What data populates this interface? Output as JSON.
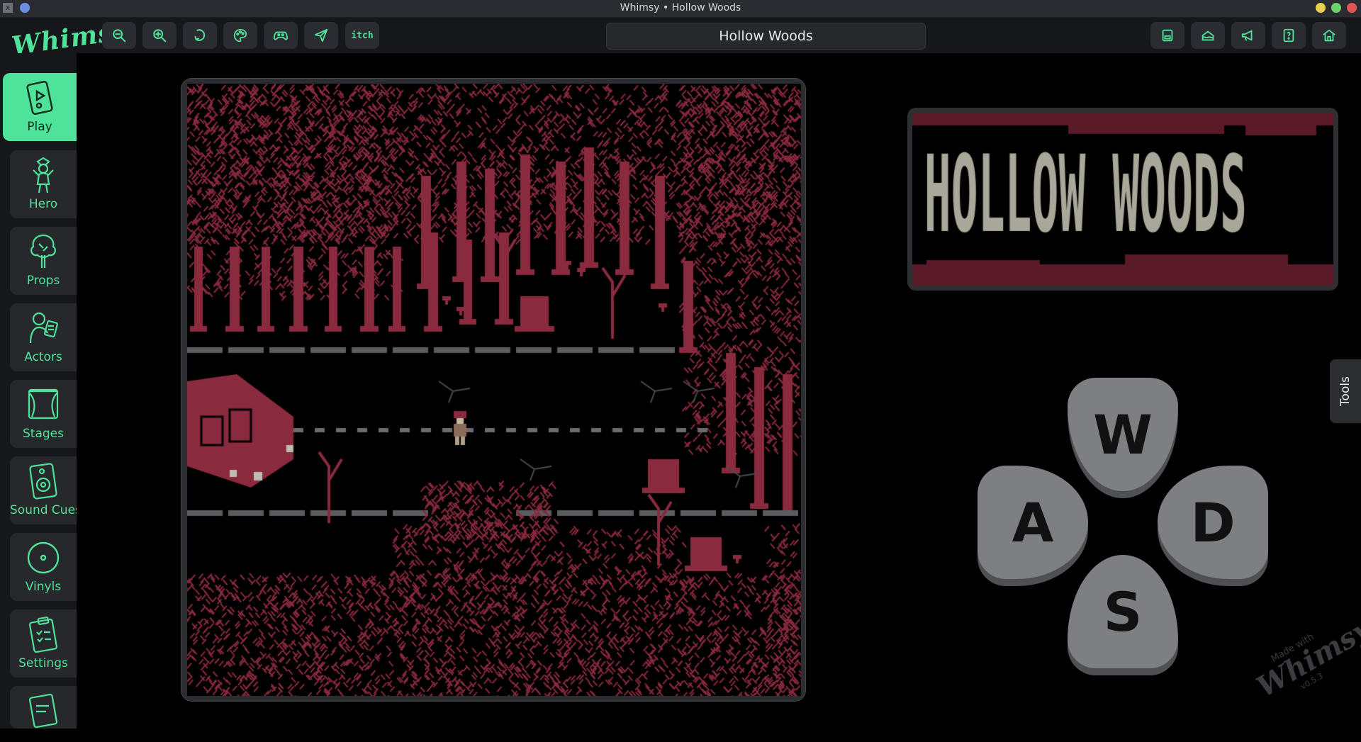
{
  "window": {
    "title": "Whimsy • Hollow Woods",
    "close_glyph": "x"
  },
  "app": {
    "logo": "Whimsy"
  },
  "toolbar": {
    "game_name": "Hollow Woods",
    "itch_label": "itch",
    "left_icons": [
      "zoom-out-icon",
      "zoom-in-icon",
      "reload-icon",
      "palette-icon",
      "gamepad-icon",
      "send-icon",
      "itch-icon"
    ],
    "right_icons": [
      "save-icon",
      "cake-icon",
      "megaphone-icon",
      "help-icon",
      "home-icon"
    ]
  },
  "sidebar": {
    "items": [
      {
        "label": "Play",
        "icon": "play-card-icon",
        "active": true
      },
      {
        "label": "Hero",
        "icon": "hero-icon"
      },
      {
        "label": "Props",
        "icon": "tree-icon"
      },
      {
        "label": "Actors",
        "icon": "actor-icon"
      },
      {
        "label": "Stages",
        "icon": "stage-icon"
      },
      {
        "label": "Sound Cues",
        "icon": "speaker-icon"
      },
      {
        "label": "Vinyls",
        "icon": "vinyl-icon"
      },
      {
        "label": "Settings",
        "icon": "clipboard-icon"
      }
    ]
  },
  "game": {
    "title_art": "HOLLOW WOODS",
    "keys": {
      "up": "W",
      "left": "A",
      "right": "D",
      "down": "S"
    },
    "colors": {
      "maroon": "#8a2a3e",
      "dark_maroon": "#5a1a28",
      "road": "#5a5c60",
      "title_fg": "#a9a79a"
    }
  },
  "tools_tab": {
    "label": "Tools"
  },
  "watermark": {
    "line1": "Made with",
    "brand": "Whimsy",
    "version": "v0.5.3"
  }
}
